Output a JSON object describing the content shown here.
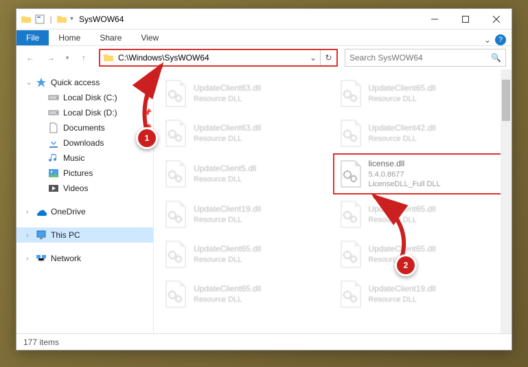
{
  "window": {
    "title": "SysWOW64"
  },
  "tabs": {
    "file": "File",
    "home": "Home",
    "share": "Share",
    "view": "View"
  },
  "nav": {
    "path": "C:\\Windows\\SysWOW64",
    "search_placeholder": "Search SysWOW64"
  },
  "sidebar": {
    "quick_access": "Quick access",
    "local_c": "Local Disk (C:)",
    "local_d": "Local Disk (D:)",
    "documents": "Documents",
    "downloads": "Downloads",
    "music": "Music",
    "pictures": "Pictures",
    "videos": "Videos",
    "onedrive": "OneDrive",
    "this_pc": "This PC",
    "network": "Network"
  },
  "files": [
    {
      "name": "UpdateClient63.dll",
      "type": "Resource DLL"
    },
    {
      "name": "UpdateClient65.dll",
      "type": "Resource DLL"
    },
    {
      "name": "UpdateClient63.dll",
      "type": "Resource DLL"
    },
    {
      "name": "UpdateClient42.dll",
      "type": "Resource DLL"
    },
    {
      "name": "UpdateClient5.dll",
      "type": "Resource DLL"
    },
    {
      "name": "license.dll",
      "line2": "5.4.0.8677",
      "line3": "LicenseDLL_Full DLL",
      "highlighted": true
    },
    {
      "name": "UpdateClient19.dll",
      "type": "Resource DLL"
    },
    {
      "name": "UpdateClient65.dll",
      "type": "Resource DLL"
    },
    {
      "name": "UpdateClient65.dll",
      "type": "Resource DLL"
    },
    {
      "name": "UpdateClient65.dll",
      "type": "Resource DLL"
    },
    {
      "name": "UpdateClient65.dll",
      "type": "Resource DLL"
    },
    {
      "name": "UpdateClient19.dll",
      "type": "Resource DLL"
    }
  ],
  "statusbar": {
    "count": "177 items"
  },
  "callouts": {
    "one": "1",
    "two": "2"
  }
}
